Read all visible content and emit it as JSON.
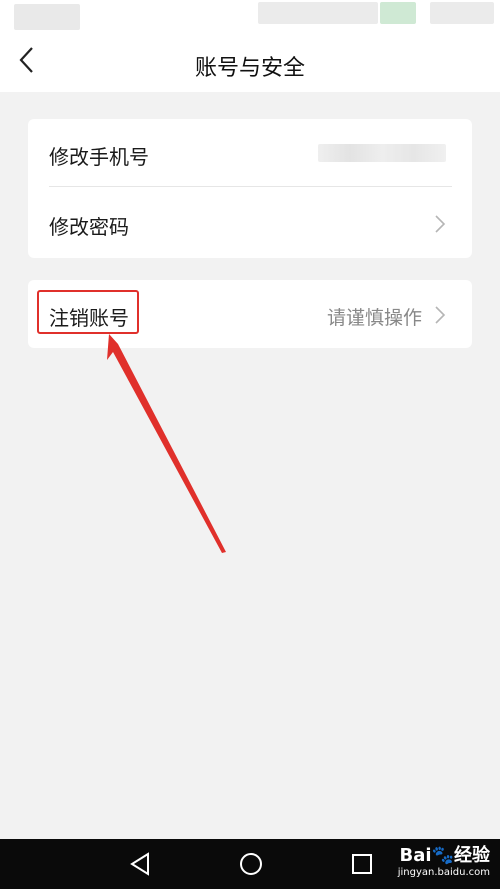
{
  "nav": {
    "title": "账号与安全"
  },
  "card1": {
    "rows": [
      {
        "label": "修改手机号"
      },
      {
        "label": "修改密码"
      }
    ]
  },
  "card2": {
    "rows": [
      {
        "label": "注销账号",
        "value": "请谨慎操作"
      }
    ]
  },
  "colors": {
    "highlight": "#e0302b",
    "background": "#f2f2f2"
  },
  "watermark": {
    "brand": "Bai🐾经验",
    "url": "jingyan.baidu.com"
  },
  "icons": [
    "back-icon",
    "chevron-right-icon",
    "triangle-back-icon",
    "circle-home-icon",
    "square-recents-icon"
  ]
}
